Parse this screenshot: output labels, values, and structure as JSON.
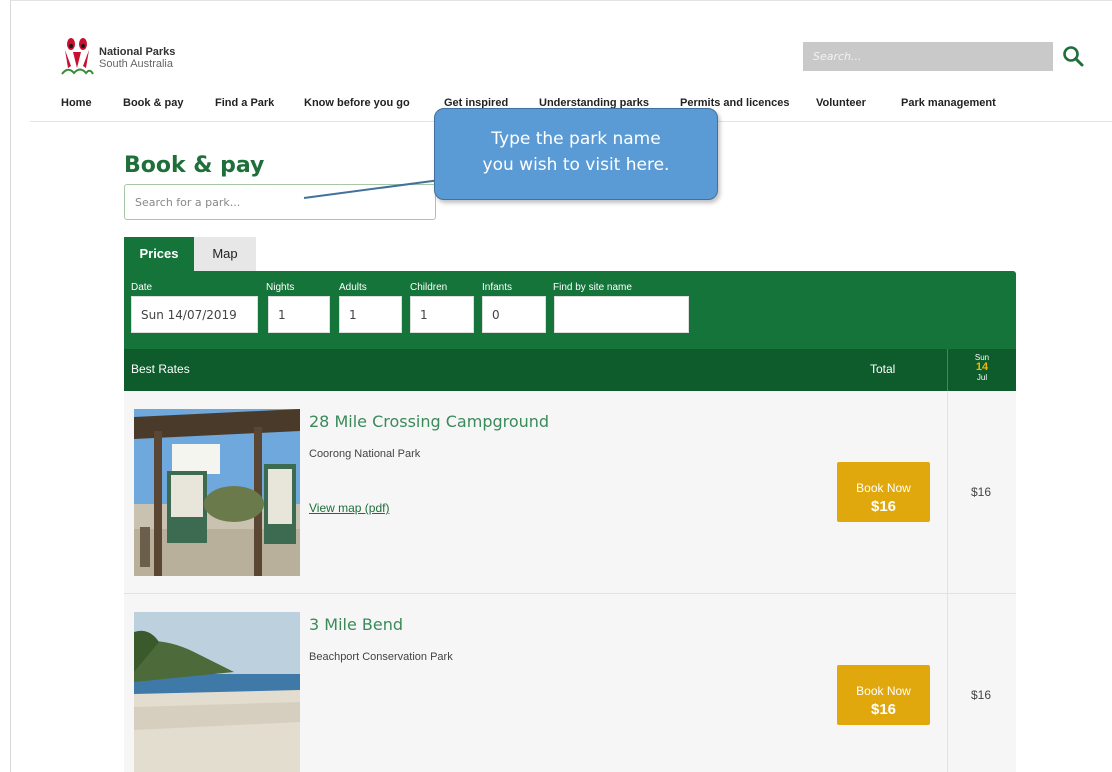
{
  "brand": {
    "line1": "National Parks",
    "line2": "South Australia"
  },
  "site_search": {
    "placeholder": "Search..."
  },
  "nav": [
    "Home",
    "Book & pay",
    "Find a Park",
    "Know before you go",
    "Get inspired",
    "Understanding parks",
    "Permits and licences",
    "Volunteer",
    "Park management"
  ],
  "page": {
    "title": "Book & pay",
    "park_search_placeholder": "Search for a park..."
  },
  "callout": {
    "line1": "Type the park name",
    "line2": "you wish to visit here."
  },
  "tabs": {
    "prices": "Prices",
    "map": "Map"
  },
  "filters": {
    "date_label": "Date",
    "date_value": "Sun 14/07/2019",
    "nights_label": "Nights",
    "nights_value": "1",
    "adults_label": "Adults",
    "adults_value": "1",
    "children_label": "Children",
    "children_value": "1",
    "infants_label": "Infants",
    "infants_value": "0",
    "site_label": "Find by site name",
    "site_value": ""
  },
  "results_header": {
    "best_rates": "Best Rates",
    "total": "Total",
    "dow": "Sun",
    "day": "14",
    "month": "Jul"
  },
  "results": [
    {
      "site": "28 Mile Crossing Campground",
      "park": "Coorong National Park",
      "link": "View map (pdf)",
      "book_label": "Book Now",
      "book_price": "$16",
      "price": "$16"
    },
    {
      "site": "3 Mile Bend",
      "park": "Beachport Conservation Park",
      "book_label": "Book Now",
      "book_price": "$16",
      "price": "$16"
    }
  ],
  "colors": {
    "brand_green": "#14743a",
    "dark_green": "#0e5c2c",
    "book_button": "#e0a80c",
    "callout_blue": "#5b9bd5"
  }
}
